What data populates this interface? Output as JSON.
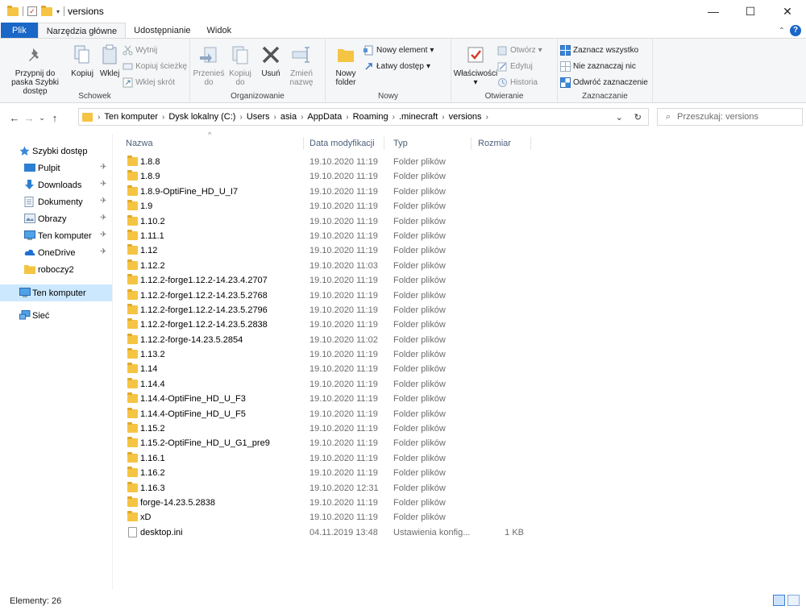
{
  "window": {
    "title": "versions",
    "minimize": "—",
    "maximize": "☐",
    "close": "✕"
  },
  "ribbon_tabs": [
    "Plik",
    "Narzędzia główne",
    "Udostępnianie",
    "Widok"
  ],
  "ribbon": {
    "schowek": {
      "label": "Schowek",
      "pin": "Przypnij do paska Szybki dostęp",
      "copy": "Kopiuj",
      "paste": "Wklej",
      "cut": "Wytnij",
      "copy_path": "Kopiuj ścieżkę",
      "paste_shortcut": "Wklej skrót"
    },
    "organizowanie": {
      "label": "Organizowanie",
      "move_to": "Przenieś do",
      "copy_to": "Kopiuj do",
      "delete": "Usuń",
      "rename": "Zmień nazwę"
    },
    "nowy": {
      "label": "Nowy",
      "new_folder": "Nowy folder",
      "new_item": "Nowy element",
      "easy_access": "Łatwy dostęp"
    },
    "otwieranie": {
      "label": "Otwieranie",
      "properties": "Właściwości",
      "open": "Otwórz",
      "edit": "Edytuj",
      "history": "Historia"
    },
    "zaznaczanie": {
      "label": "Zaznaczanie",
      "select_all": "Zaznacz wszystko",
      "select_none": "Nie zaznaczaj nic",
      "invert": "Odwróć zaznaczenie"
    }
  },
  "address": {
    "crumbs": [
      "Ten komputer",
      "Dysk lokalny (C:)",
      "Users",
      "asia",
      "AppData",
      "Roaming",
      ".minecraft",
      "versions"
    ]
  },
  "search": {
    "placeholder": "Przeszukaj: versions"
  },
  "sidebar": [
    {
      "label": "Szybki dostęp",
      "icon": "star-icon",
      "pinned": false,
      "level": 0,
      "selected": false
    },
    {
      "label": "Pulpit",
      "icon": "desktop-icon",
      "pinned": true,
      "level": 1,
      "selected": false
    },
    {
      "label": "Downloads",
      "icon": "download-icon",
      "pinned": true,
      "level": 1,
      "selected": false
    },
    {
      "label": "Dokumenty",
      "icon": "documents-icon",
      "pinned": true,
      "level": 1,
      "selected": false
    },
    {
      "label": "Obrazy",
      "icon": "pictures-icon",
      "pinned": true,
      "level": 1,
      "selected": false
    },
    {
      "label": "Ten komputer",
      "icon": "computer-icon",
      "pinned": true,
      "level": 1,
      "selected": false
    },
    {
      "label": "OneDrive",
      "icon": "cloud-icon",
      "pinned": true,
      "level": 1,
      "selected": false
    },
    {
      "label": "roboczy2",
      "icon": "folder-icon",
      "pinned": false,
      "level": 1,
      "selected": false
    },
    {
      "label": "Ten komputer",
      "icon": "computer-icon",
      "pinned": false,
      "level": 0,
      "selected": true
    },
    {
      "label": "Sieć",
      "icon": "network-icon",
      "pinned": false,
      "level": 0,
      "selected": false
    }
  ],
  "columns": {
    "name": "Nazwa",
    "date": "Data modyfikacji",
    "type": "Typ",
    "size": "Rozmiar"
  },
  "files": [
    {
      "name": "1.8.8",
      "date": "19.10.2020 11:19",
      "type": "Folder plików",
      "size": ""
    },
    {
      "name": "1.8.9",
      "date": "19.10.2020 11:19",
      "type": "Folder plików",
      "size": ""
    },
    {
      "name": "1.8.9-OptiFine_HD_U_I7",
      "date": "19.10.2020 11:19",
      "type": "Folder plików",
      "size": ""
    },
    {
      "name": "1.9",
      "date": "19.10.2020 11:19",
      "type": "Folder plików",
      "size": ""
    },
    {
      "name": "1.10.2",
      "date": "19.10.2020 11:19",
      "type": "Folder plików",
      "size": ""
    },
    {
      "name": "1.11.1",
      "date": "19.10.2020 11:19",
      "type": "Folder plików",
      "size": ""
    },
    {
      "name": "1.12",
      "date": "19.10.2020 11:19",
      "type": "Folder plików",
      "size": ""
    },
    {
      "name": "1.12.2",
      "date": "19.10.2020 11:03",
      "type": "Folder plików",
      "size": ""
    },
    {
      "name": "1.12.2-forge1.12.2-14.23.4.2707",
      "date": "19.10.2020 11:19",
      "type": "Folder plików",
      "size": ""
    },
    {
      "name": "1.12.2-forge1.12.2-14.23.5.2768",
      "date": "19.10.2020 11:19",
      "type": "Folder plików",
      "size": ""
    },
    {
      "name": "1.12.2-forge1.12.2-14.23.5.2796",
      "date": "19.10.2020 11:19",
      "type": "Folder plików",
      "size": ""
    },
    {
      "name": "1.12.2-forge1.12.2-14.23.5.2838",
      "date": "19.10.2020 11:19",
      "type": "Folder plików",
      "size": ""
    },
    {
      "name": "1.12.2-forge-14.23.5.2854",
      "date": "19.10.2020 11:02",
      "type": "Folder plików",
      "size": ""
    },
    {
      "name": "1.13.2",
      "date": "19.10.2020 11:19",
      "type": "Folder plików",
      "size": ""
    },
    {
      "name": "1.14",
      "date": "19.10.2020 11:19",
      "type": "Folder plików",
      "size": ""
    },
    {
      "name": "1.14.4",
      "date": "19.10.2020 11:19",
      "type": "Folder plików",
      "size": ""
    },
    {
      "name": "1.14.4-OptiFine_HD_U_F3",
      "date": "19.10.2020 11:19",
      "type": "Folder plików",
      "size": ""
    },
    {
      "name": "1.14.4-OptiFine_HD_U_F5",
      "date": "19.10.2020 11:19",
      "type": "Folder plików",
      "size": ""
    },
    {
      "name": "1.15.2",
      "date": "19.10.2020 11:19",
      "type": "Folder plików",
      "size": ""
    },
    {
      "name": "1.15.2-OptiFine_HD_U_G1_pre9",
      "date": "19.10.2020 11:19",
      "type": "Folder plików",
      "size": ""
    },
    {
      "name": "1.16.1",
      "date": "19.10.2020 11:19",
      "type": "Folder plików",
      "size": ""
    },
    {
      "name": "1.16.2",
      "date": "19.10.2020 11:19",
      "type": "Folder plików",
      "size": ""
    },
    {
      "name": "1.16.3",
      "date": "19.10.2020 12:31",
      "type": "Folder plików",
      "size": ""
    },
    {
      "name": "forge-14.23.5.2838",
      "date": "19.10.2020 11:19",
      "type": "Folder plików",
      "size": ""
    },
    {
      "name": "xD",
      "date": "19.10.2020 11:19",
      "type": "Folder plików",
      "size": ""
    },
    {
      "name": "desktop.ini",
      "date": "04.11.2019 13:48",
      "type": "Ustawienia konfig...",
      "size": "1 KB",
      "is_file": true
    }
  ],
  "status": {
    "items": "Elementy: 26"
  },
  "colors": {
    "accent": "#1a67c7",
    "selection": "#cce8ff",
    "folder": "#f5c443"
  }
}
